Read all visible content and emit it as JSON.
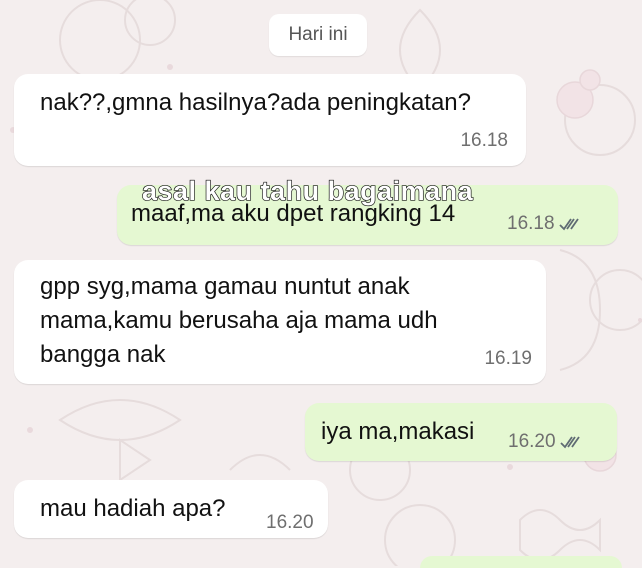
{
  "date_chip": "Hari ini",
  "messages": [
    {
      "id": "m1",
      "direction": "incoming",
      "text": "nak??,gmna hasilnya?ada peningkatan?",
      "time": "16.18"
    },
    {
      "id": "m2",
      "direction": "outgoing",
      "text": "maaf,ma aku dpet rangking 14",
      "time": "16.18",
      "status": "read-ticks"
    },
    {
      "id": "m3",
      "direction": "incoming",
      "text": "gpp syg,mama gamau nuntut anak\nmama,kamu berusaha aja mama udh\nbangga nak",
      "time": "16.19"
    },
    {
      "id": "m4",
      "direction": "outgoing",
      "text": "iya ma,makasi",
      "time": "16.20",
      "status": "read-ticks"
    },
    {
      "id": "m5",
      "direction": "incoming",
      "text": "mau hadiah apa?",
      "time": "16.20"
    }
  ],
  "overlay_caption": "asal kau tahu bagaimana",
  "colors": {
    "background": "#f4eeee",
    "incoming_bubble": "#ffffff",
    "outgoing_bubble": "#e5f8d2",
    "timestamp": "#6f6f6f",
    "ticks": "#5f6b73"
  }
}
